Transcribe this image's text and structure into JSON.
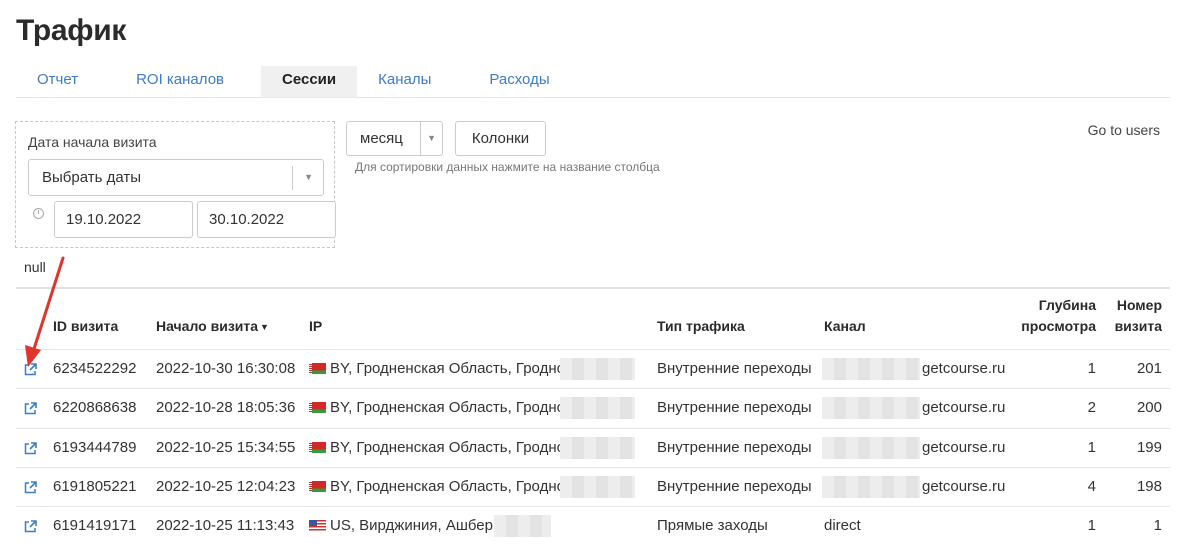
{
  "page": {
    "title": "Трафик"
  },
  "tabs": [
    {
      "label": "Отчет",
      "active": false
    },
    {
      "label": "ROI каналов",
      "active": false
    },
    {
      "label": "Сессии",
      "active": true
    },
    {
      "label": "Каналы",
      "active": false
    },
    {
      "label": "Расходы",
      "active": false
    }
  ],
  "filters": {
    "visit_start_label": "Дата начала визита",
    "date_select_value": "Выбрать даты",
    "date_from": "19.10.2022",
    "date_to": "30.10.2022",
    "null_text": "null",
    "period_value": "месяц",
    "columns_label": "Колонки",
    "sort_hint": "Для сортировки данных нажмите на название столбца",
    "go_to_users": "Go to users"
  },
  "table": {
    "headers": {
      "visit_id": "ID визита",
      "visit_start": "Начало визита",
      "ip": "IP",
      "traffic_type": "Тип трафика",
      "channel": "Канал",
      "depth_line1": "Глубина",
      "depth_line2": "просмотра",
      "visit_number_line1": "Номер",
      "visit_number_line2": "визита"
    },
    "sorted_by": "visit_start",
    "rows": [
      {
        "id": "6234522292",
        "start": "2022-10-30 16:30:08",
        "country": "BY",
        "location": "BY, Гродненская Область, Гродно",
        "traffic_type": "Внутренние переходы",
        "channel": "getcourse.ru",
        "depth": "1",
        "visit_number": "201"
      },
      {
        "id": "6220868638",
        "start": "2022-10-28 18:05:36",
        "country": "BY",
        "location": "BY, Гродненская Область, Гродно",
        "traffic_type": "Внутренние переходы",
        "channel": "getcourse.ru",
        "depth": "2",
        "visit_number": "200"
      },
      {
        "id": "6193444789",
        "start": "2022-10-25 15:34:55",
        "country": "BY",
        "location": "BY, Гродненская Область, Гродно",
        "traffic_type": "Внутренние переходы",
        "channel": "getcourse.ru",
        "depth": "1",
        "visit_number": "199"
      },
      {
        "id": "6191805221",
        "start": "2022-10-25 12:04:23",
        "country": "BY",
        "location": "BY, Гродненская Область, Гродно",
        "traffic_type": "Внутренние переходы",
        "channel": "getcourse.ru",
        "depth": "4",
        "visit_number": "198"
      },
      {
        "id": "6191419171",
        "start": "2022-10-25 11:13:43",
        "country": "US",
        "location": "US, Вирджиния, Ашберн",
        "traffic_type": "Прямые заходы",
        "channel": "direct",
        "depth": "1",
        "visit_number": "1"
      }
    ]
  },
  "colors": {
    "link": "#3d7cc9",
    "annotation_arrow": "#e0352b"
  }
}
